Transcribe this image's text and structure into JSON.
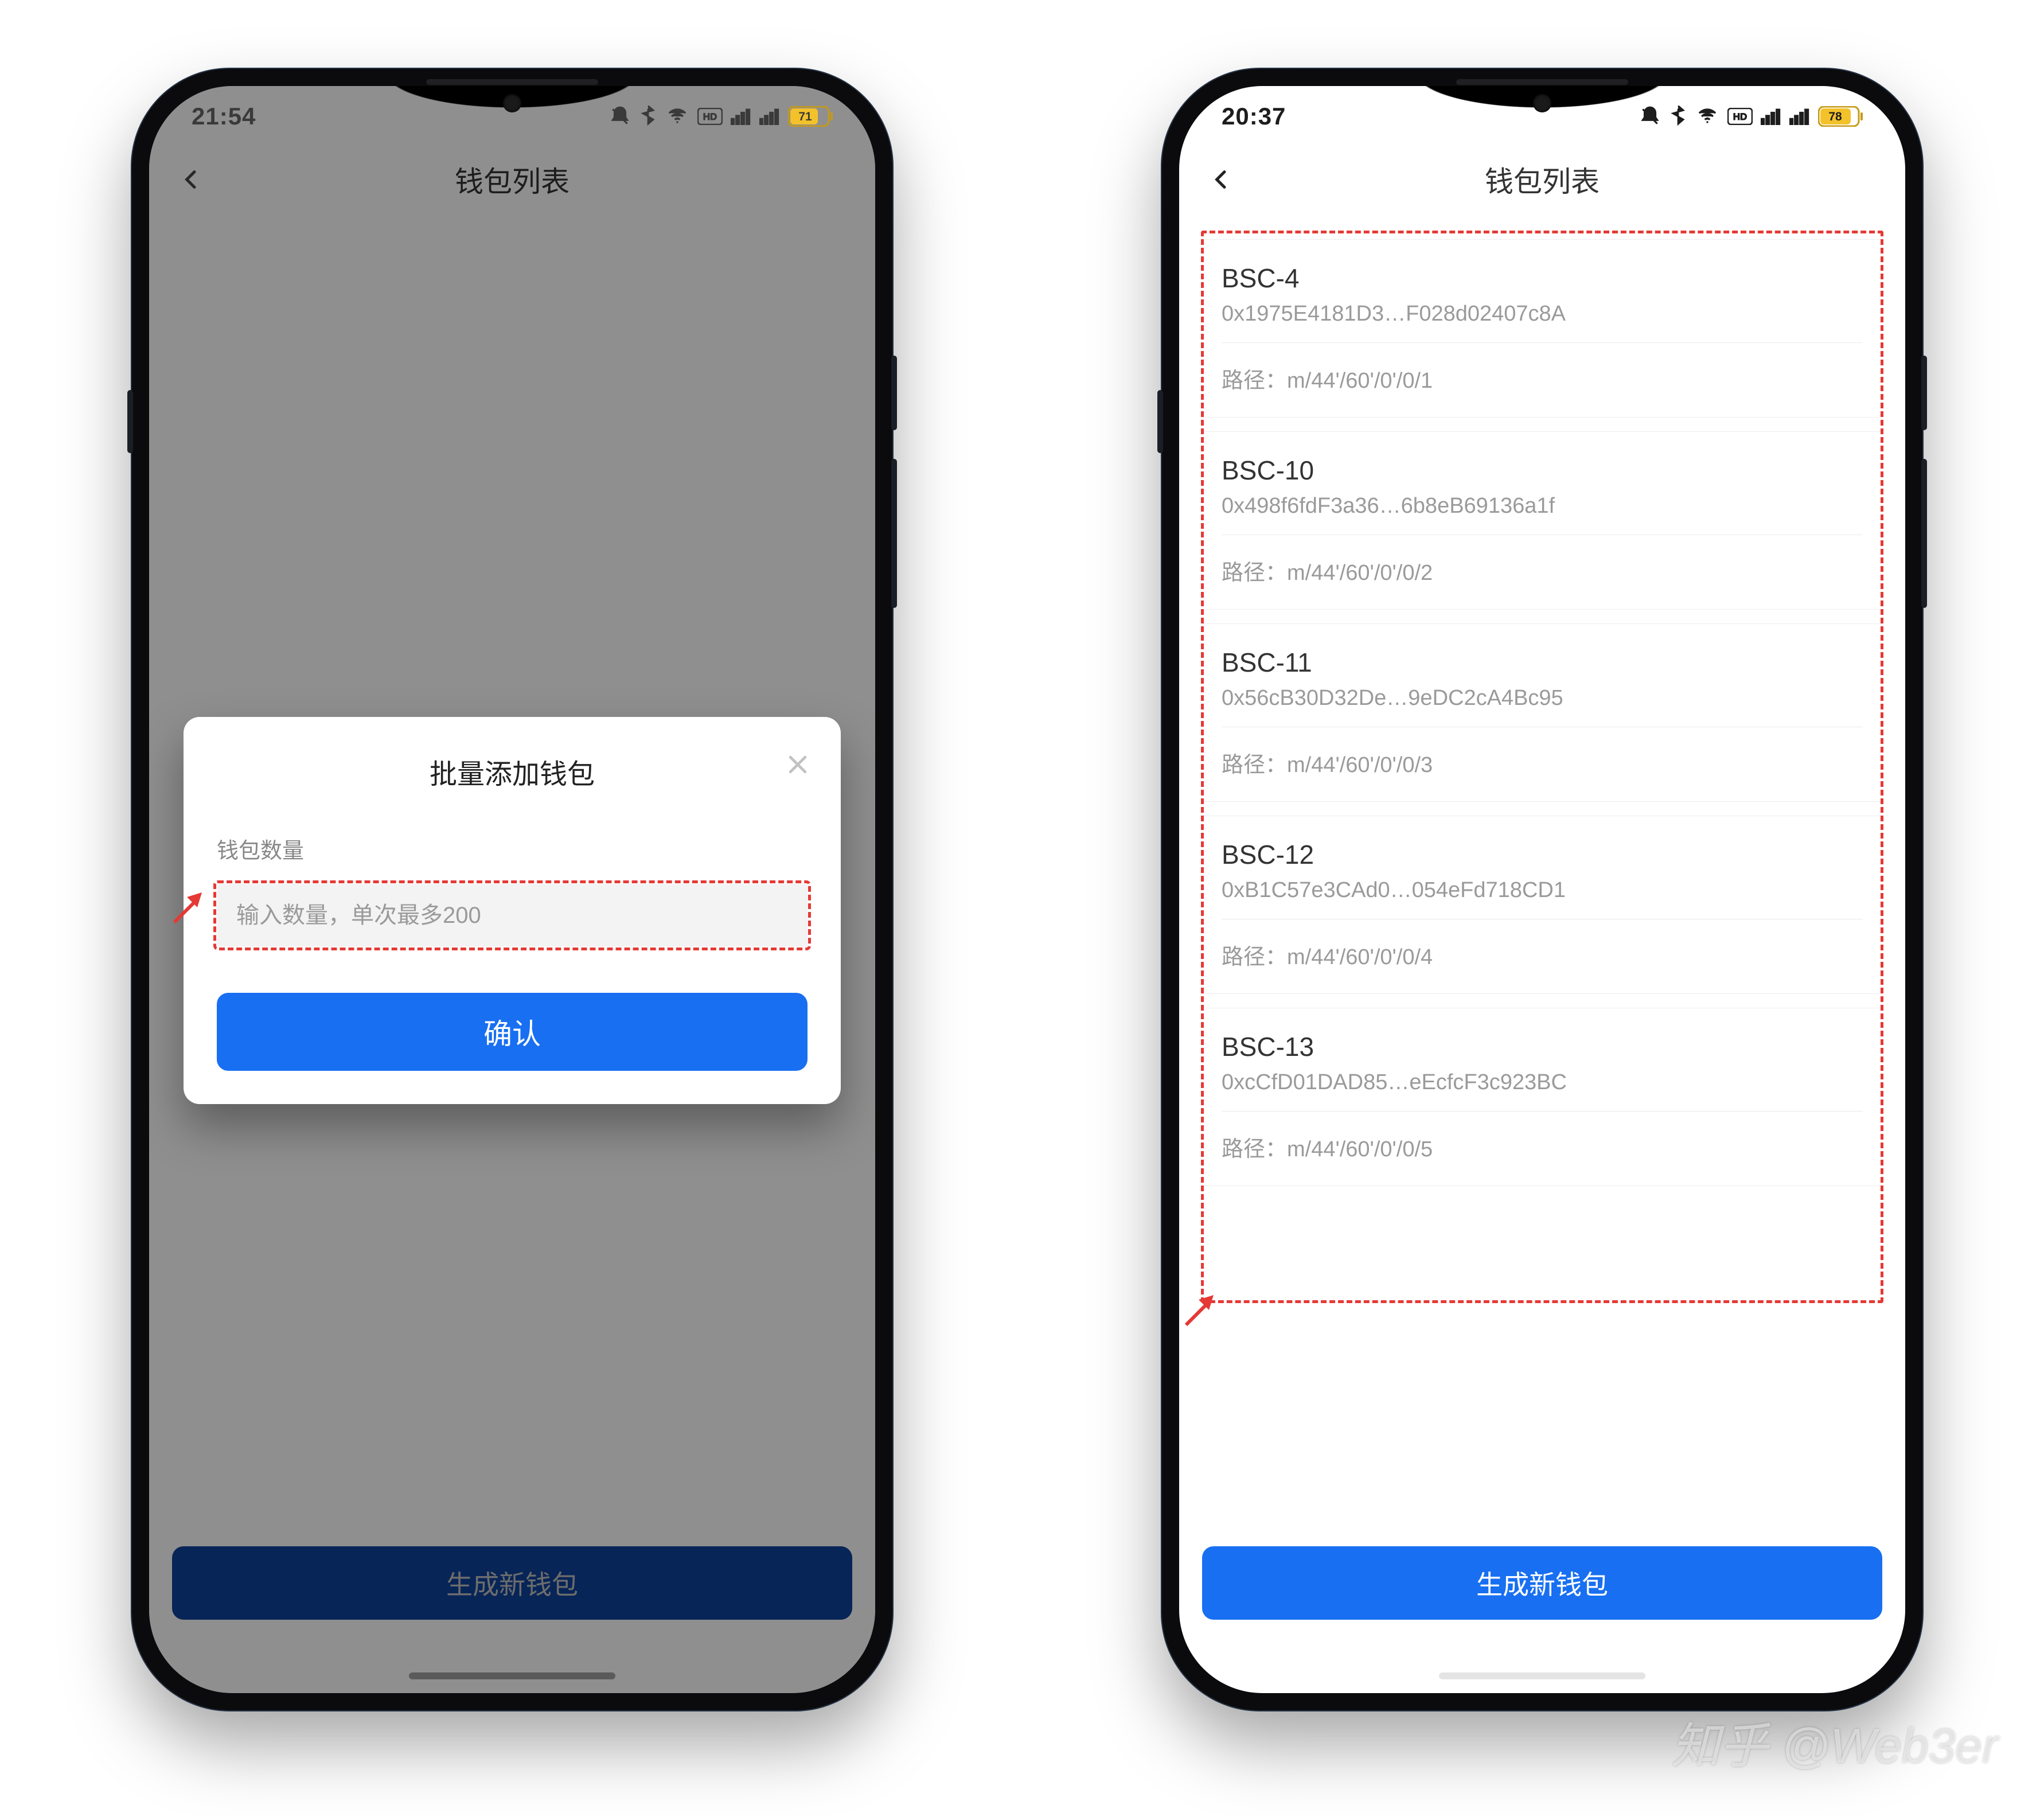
{
  "watermark": "知乎 @Web3er",
  "header_title": "钱包列表",
  "generate_button_label": "生成新钱包",
  "phone_left": {
    "status": {
      "time": "21:54",
      "battery_percent": "71"
    },
    "modal": {
      "title": "批量添加钱包",
      "field_label": "钱包数量",
      "placeholder": "输入数量，单次最多200",
      "confirm_label": "确认"
    }
  },
  "phone_right": {
    "status": {
      "time": "20:37",
      "battery_percent": "78"
    },
    "path_prefix": "路径：",
    "wallets": [
      {
        "name": "BSC-4",
        "address": "0x1975E4181D3…F028d02407c8A",
        "path": "m/44'/60'/0'/0/1"
      },
      {
        "name": "BSC-10",
        "address": "0x498f6fdF3a36…6b8eB69136a1f",
        "path": "m/44'/60'/0'/0/2"
      },
      {
        "name": "BSC-11",
        "address": "0x56cB30D32De…9eDC2cA4Bc95",
        "path": "m/44'/60'/0'/0/3"
      },
      {
        "name": "BSC-12",
        "address": "0xB1C57e3CAd0…054eFd718CD1",
        "path": "m/44'/60'/0'/0/4"
      },
      {
        "name": "BSC-13",
        "address": "0xcCfD01DAD85…eEcfcF3c923BC",
        "path": "m/44'/60'/0'/0/5"
      }
    ]
  },
  "colors": {
    "primary_blue": "#186FF2",
    "annotation_red": "#e53935",
    "text_muted": "#9a9a9a"
  }
}
